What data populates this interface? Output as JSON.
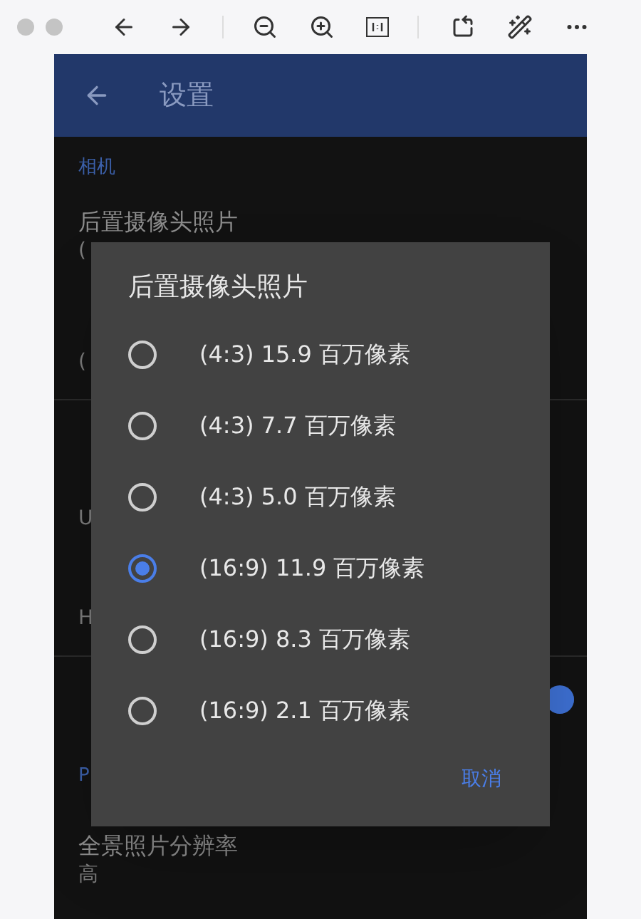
{
  "app_bar": {
    "title": "设置"
  },
  "settings": [
    {
      "kind": "section",
      "label": "相机"
    },
    {
      "kind": "item",
      "title": "后置摄像头照片",
      "value": "("
    },
    {
      "kind": "item",
      "value": "("
    },
    {
      "kind": "section"
    },
    {
      "kind": "item",
      "value": "U"
    },
    {
      "kind": "item",
      "value": "H"
    },
    {
      "kind": "switch",
      "on": true
    },
    {
      "kind": "section",
      "label": "P"
    },
    {
      "kind": "item",
      "title": "全景照片分辨率",
      "value": "高"
    }
  ],
  "dialog": {
    "title": "后置摄像头照片",
    "options": [
      {
        "label": "(4:3) 15.9 百万像素",
        "selected": false
      },
      {
        "label": "(4:3) 7.7 百万像素",
        "selected": false
      },
      {
        "label": "(4:3) 5.0 百万像素",
        "selected": false
      },
      {
        "label": "(16:9) 11.9 百万像素",
        "selected": true
      },
      {
        "label": "(16:9) 8.3 百万像素",
        "selected": false
      },
      {
        "label": "(16:9) 2.1 百万像素",
        "selected": false
      }
    ],
    "cancel": "取消"
  }
}
